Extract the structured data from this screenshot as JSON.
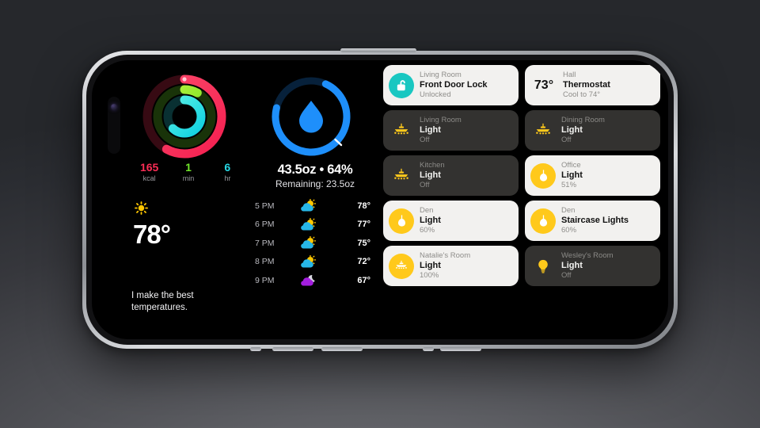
{
  "device": {
    "name": "iphone-landscape",
    "frame_color": "#b9bbc0"
  },
  "activity": {
    "rings": [
      {
        "name": "move",
        "color": "#fa2d55",
        "progress": 0.58
      },
      {
        "name": "exercise",
        "color": "#71e62a",
        "progress": 0.08
      },
      {
        "name": "stand",
        "color": "#27d9e5",
        "progress": 0.62
      }
    ],
    "metrics": [
      {
        "name": "move",
        "value": "165",
        "unit": "kcal",
        "color": "#fa2d55"
      },
      {
        "name": "exercise",
        "value": "1",
        "unit": "min",
        "color": "#71e62a"
      },
      {
        "name": "stand",
        "value": "6",
        "unit": "hr",
        "color": "#27d9e5"
      }
    ]
  },
  "weather": {
    "icon": "sun-icon",
    "temperature": "78°",
    "quote": "I make the best temperatures.",
    "forecast": [
      {
        "time": "5 PM",
        "icon": "sun-behind-cloud-icon",
        "temp": "78°"
      },
      {
        "time": "6 PM",
        "icon": "sun-behind-cloud-icon",
        "temp": "77°"
      },
      {
        "time": "7 PM",
        "icon": "sun-behind-cloud-icon",
        "temp": "75°"
      },
      {
        "time": "8 PM",
        "icon": "sun-behind-cloud-icon",
        "temp": "72°"
      },
      {
        "time": "9 PM",
        "icon": "moon-behind-cloud-icon",
        "temp": "67°"
      }
    ]
  },
  "water": {
    "icon": "water-drop-icon",
    "ring_color": "#1e8ffb",
    "progress": 0.64,
    "headline": "43.5oz • 64%",
    "remaining": "Remaining: 23.5oz"
  },
  "home": {
    "tiles": [
      {
        "room": "Living Room",
        "name": "Front Door Lock",
        "state": "Unlocked",
        "on": true,
        "icon": "unlocked-padlock-icon",
        "icon_style": "teal-circle",
        "value": ""
      },
      {
        "room": "Hall",
        "name": "Thermostat",
        "state": "Cool to 74°",
        "on": true,
        "icon": "thermostat-temp-value",
        "icon_style": "temp",
        "value": "73°"
      },
      {
        "room": "Living Room",
        "name": "Light",
        "state": "Off",
        "on": false,
        "icon": "chandelier-icon",
        "icon_style": "plain",
        "value": ""
      },
      {
        "room": "Dining Room",
        "name": "Light",
        "state": "Off",
        "on": false,
        "icon": "chandelier-icon",
        "icon_style": "plain",
        "value": ""
      },
      {
        "room": "Kitchen",
        "name": "Light",
        "state": "Off",
        "on": false,
        "icon": "chandelier-icon",
        "icon_style": "plain",
        "value": ""
      },
      {
        "room": "Office",
        "name": "Light",
        "state": "51%",
        "on": true,
        "icon": "pendant-lamp-icon",
        "icon_style": "yellow-circle",
        "value": ""
      },
      {
        "room": "Den",
        "name": "Light",
        "state": "60%",
        "on": true,
        "icon": "pendant-lamp-icon",
        "icon_style": "yellow-circle",
        "value": ""
      },
      {
        "room": "Den",
        "name": "Staircase Lights",
        "state": "60%",
        "on": true,
        "icon": "pendant-lamp-icon",
        "icon_style": "yellow-circle",
        "value": ""
      },
      {
        "room": "Natalie's Room",
        "name": "Light",
        "state": "100%",
        "on": true,
        "icon": "chandelier-icon",
        "icon_style": "yellow-circle",
        "value": ""
      },
      {
        "room": "Wesley's Room",
        "name": "Light",
        "state": "Off",
        "on": false,
        "icon": "lightbulb-icon",
        "icon_style": "plain",
        "value": ""
      }
    ]
  }
}
